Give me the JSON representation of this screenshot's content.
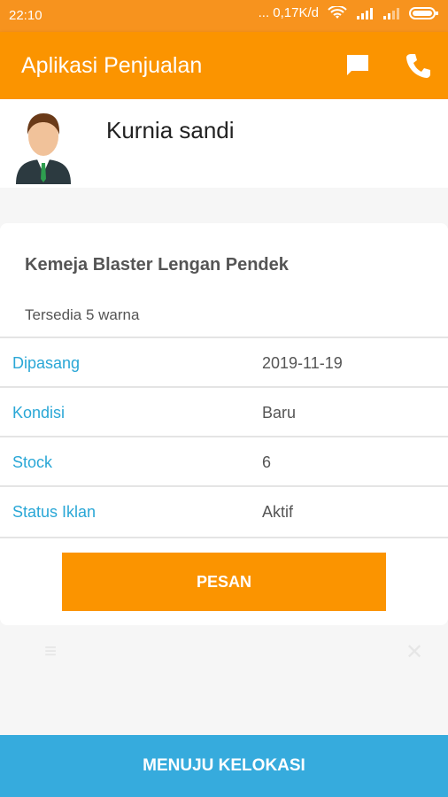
{
  "status": {
    "time": "22:10",
    "speed": "... 0,17K/d"
  },
  "app": {
    "title": "Aplikasi Penjualan",
    "chat_icon": "chat-icon",
    "phone_icon": "phone-icon"
  },
  "profile": {
    "name": "Kurnia sandi",
    "avatar_icon": "person-avatar"
  },
  "product": {
    "title": "Kemeja Blaster Lengan Pendek",
    "description": "Tersedia 5 warna",
    "details": [
      {
        "label": "Dipasang",
        "value": "2019-11-19"
      },
      {
        "label": "Kondisi",
        "value": "Baru"
      },
      {
        "label": "Stock",
        "value": "6"
      },
      {
        "label": "Status Iklan",
        "value": "Aktif"
      }
    ],
    "order_button": "PESAN"
  },
  "bottom": {
    "button": "MENUJU KELOKASI"
  },
  "colors": {
    "primary": "#fb9400",
    "accent": "#36abdd",
    "label": "#2aa7d6"
  }
}
